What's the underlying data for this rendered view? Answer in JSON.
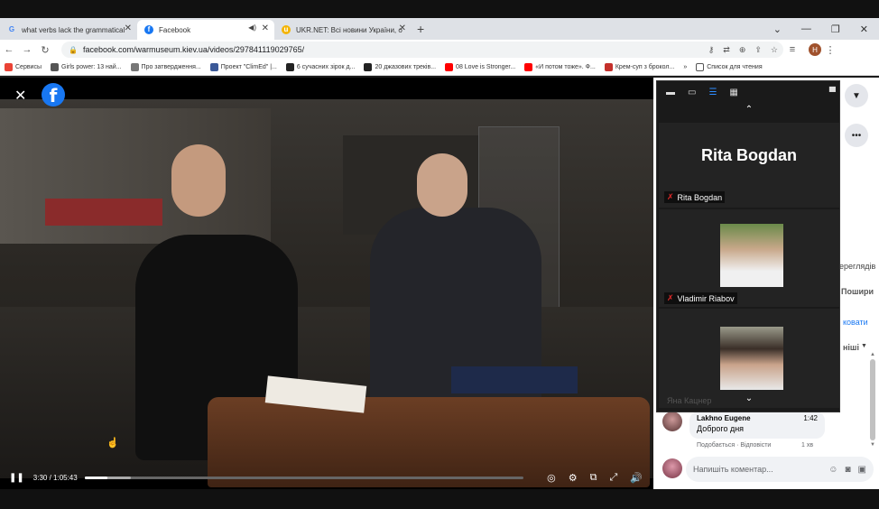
{
  "browser": {
    "tabs": [
      {
        "title": "what verbs lack the grammatical",
        "favicon": "G",
        "favicon_color": "#4285f4",
        "active": false
      },
      {
        "title": "Facebook",
        "favicon": "f",
        "favicon_color": "#1877f2",
        "active": true
      },
      {
        "title": "UKR.NET: Всі новини України, о",
        "favicon": "u",
        "favicon_color": "#f4b400",
        "active": false
      }
    ],
    "new_tab_label": "+",
    "url": "facebook.com/warmuseum.kiev.ua/videos/297841119029765/",
    "profile_initial": "H",
    "bookmarks": [
      {
        "label": "Сервисы",
        "color": "#ea4335"
      },
      {
        "label": "Girls power: 13 най...",
        "color": "#555555"
      },
      {
        "label": "Про затвердження...",
        "color": "#777777"
      },
      {
        "label": "Проект \"ClimEd\" |...",
        "color": "#3b5998"
      },
      {
        "label": "6 сучасних зірок д...",
        "color": "#222222"
      },
      {
        "label": "20 джазових треків...",
        "color": "#222222"
      },
      {
        "label": "08 Love is Stronger...",
        "color": "#ff0000"
      },
      {
        "label": "«И потом тоже». Ф...",
        "color": "#ff0000"
      },
      {
        "label": "Крем-суп з брокол...",
        "color": "#c4302b"
      }
    ],
    "bookmarks_more": "»",
    "reading_list": "Список для чтения"
  },
  "video": {
    "current_time": "3:30",
    "duration": "1:05:43",
    "progress": 0.053,
    "buffered": 0.105
  },
  "zoom_panel": {
    "speaker_name": "Rita Bogdan",
    "participants": [
      {
        "name": "Rita Bogdan",
        "muted": true
      },
      {
        "name": "Vladimir Riabov",
        "muted": true
      },
      {
        "name": "",
        "muted": false
      }
    ],
    "hidden_label": "Яна Кацнер"
  },
  "sidebar": {
    "views_fragment": "ереглядів",
    "share_fragment": "Пошири",
    "follow_fragment": "ковати",
    "more_fragment": "ніші"
  },
  "comment": {
    "author": "Lakhno Eugene",
    "time": "1:42",
    "text": "Доброго дня",
    "actions": "Подобається · Відповісти",
    "time_ago": "1 хв"
  },
  "compose": {
    "placeholder": "Напишіть коментар..."
  }
}
